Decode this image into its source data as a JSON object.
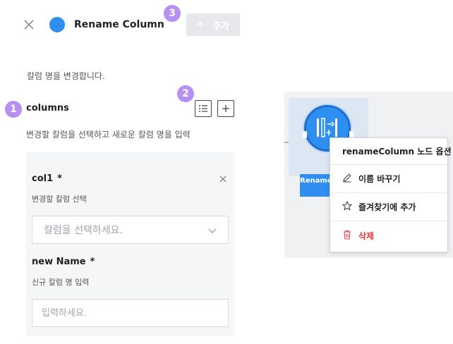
{
  "header": {
    "title": "Rename Column",
    "add_button_label": "추가",
    "add_button_icon": "plus-icon",
    "accent_color": "#2f8ff0"
  },
  "badges": [
    "1",
    "2",
    "3"
  ],
  "description": "칼럼 명을 변경합니다.",
  "columns_section": {
    "label": "columns",
    "description": "변경할 칼럼을 선택하고 새로운 칼럼 명을 입력",
    "icons": [
      "list-icon",
      "plus-icon"
    ]
  },
  "entry": {
    "col1_label": "col1",
    "col1_required": "*",
    "col1_hint": "변경할 칼럼 선택",
    "col1_placeholder": "칼럼을 선택하세요.",
    "new_name_label": "new Name",
    "new_name_required": "*",
    "new_name_hint": "신규 칼럼 명 입력",
    "new_name_placeholder": "입력하세요."
  },
  "canvas": {
    "node_label": "RenameColumn"
  },
  "context_menu": {
    "title": "renameColumn 노드 옵션",
    "items": [
      {
        "label": "이름 바꾸기",
        "icon": "pencil-icon"
      },
      {
        "label": "즐겨찾기에 추가",
        "icon": "star-icon"
      },
      {
        "label": "삭제",
        "icon": "trash-icon",
        "color": "#e03939"
      }
    ]
  }
}
